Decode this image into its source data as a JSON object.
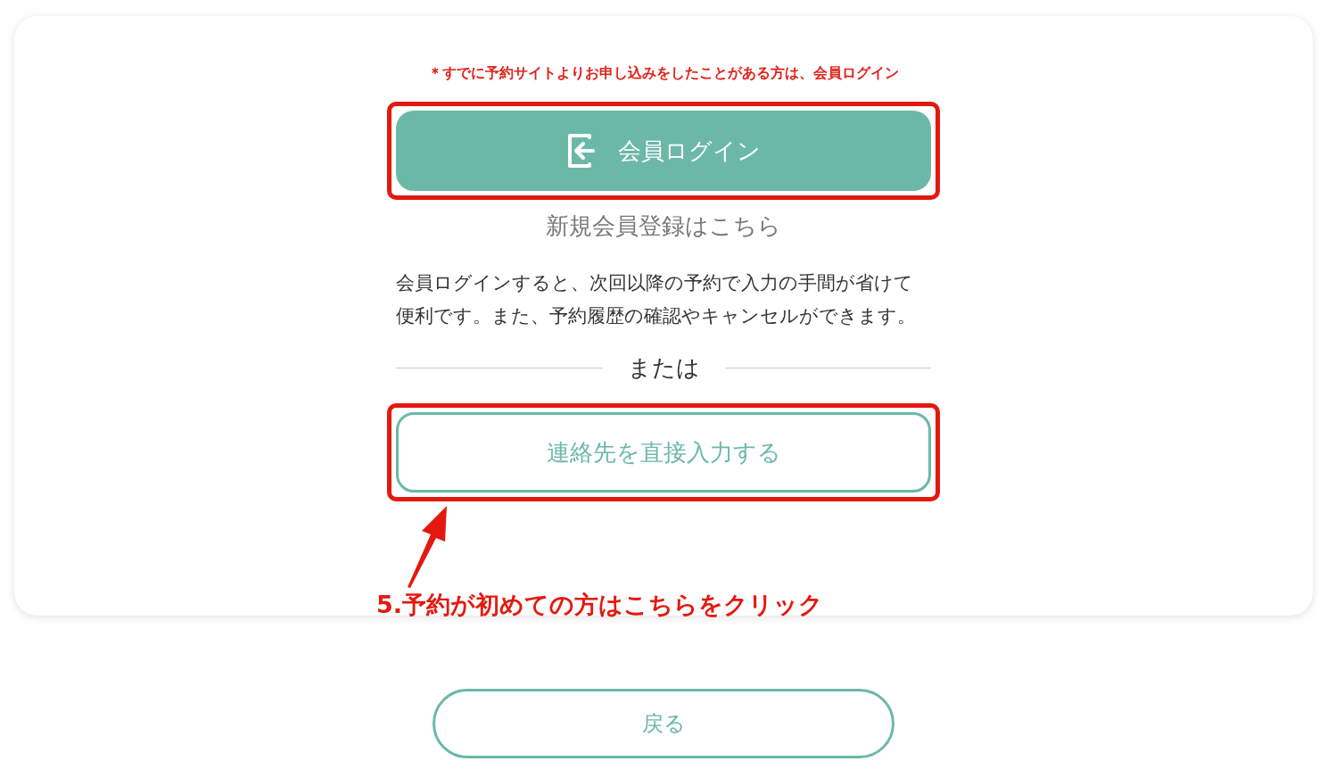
{
  "notice": "＊すでに予約サイトよりお申し込みをしたことがある方は、会員ログイン",
  "login_button": {
    "label": "会員ログイン",
    "highlighted": true
  },
  "register_link": "新規会員登録はこちら",
  "description": "会員ログインすると、次回以降の予約で入力の手間が省けて便利です。また、予約履歴の確認やキャンセルができます。",
  "divider_label": "または",
  "direct_input_button": {
    "label": "連絡先を直接入力する",
    "highlighted": true
  },
  "callout": "5.予約が初めての方はこちらをクリック",
  "back_button": "戻る"
}
